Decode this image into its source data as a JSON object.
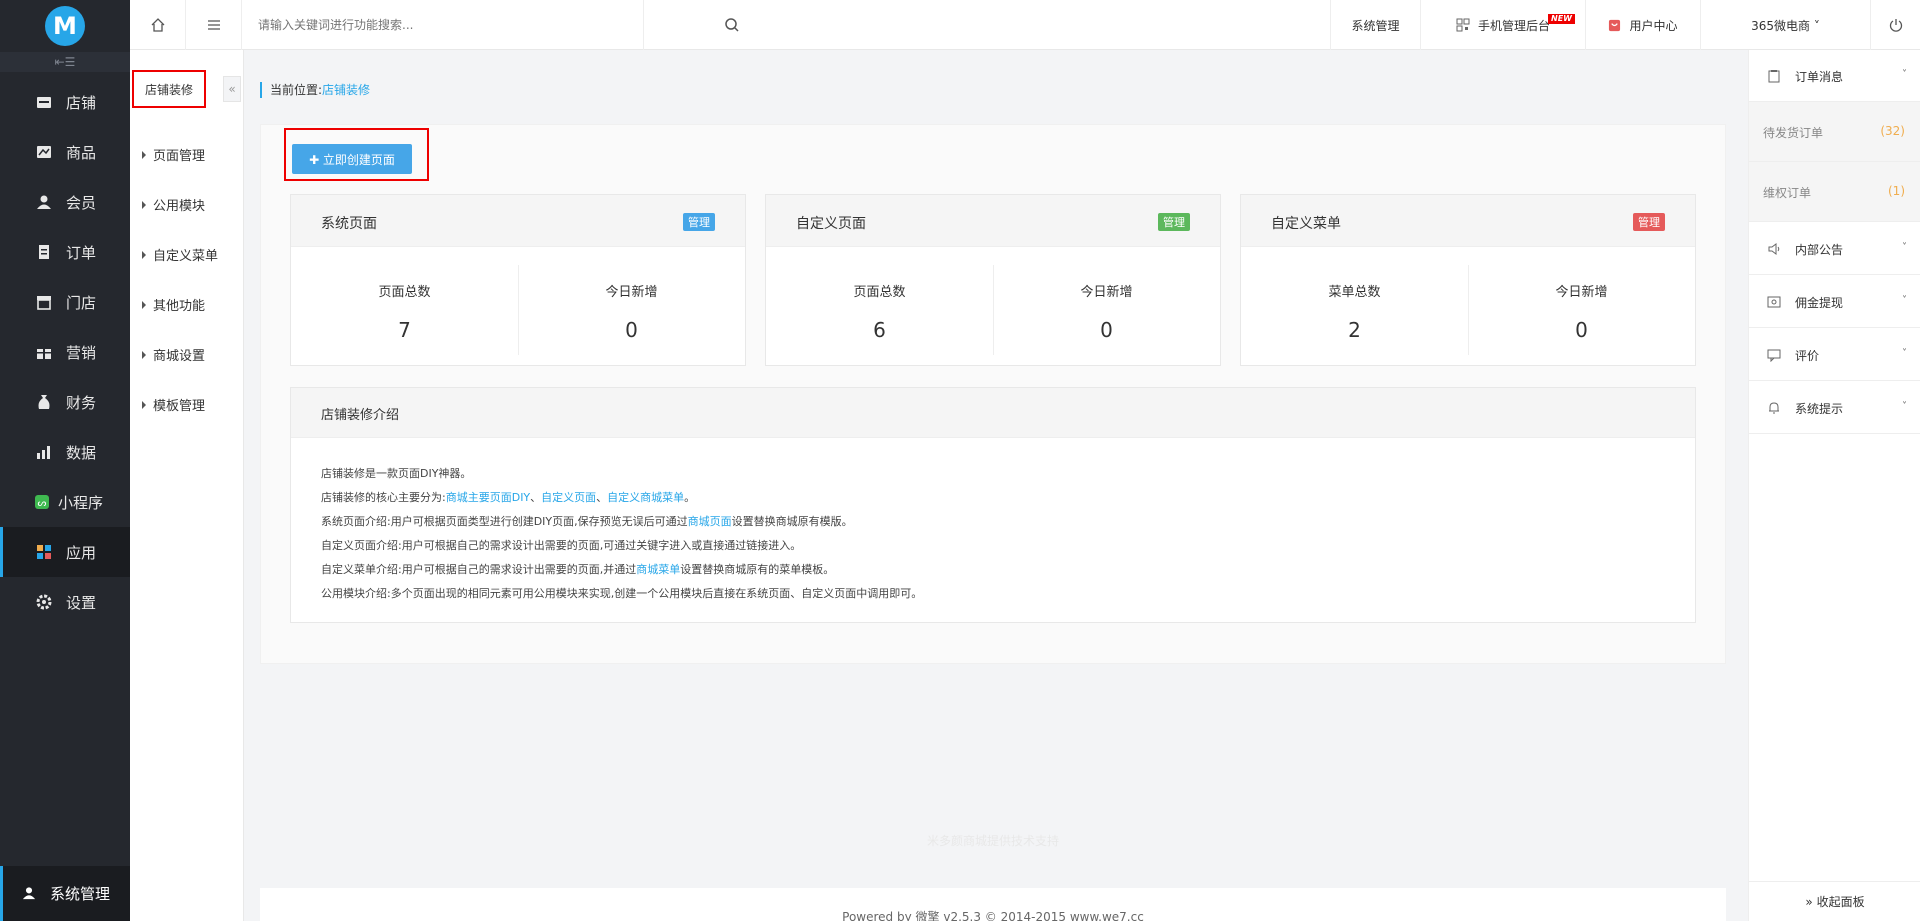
{
  "sidebar": {
    "logo": "M",
    "collapse_glyph": "⇤☰",
    "items": [
      {
        "label": "店铺",
        "icon": "store-icon"
      },
      {
        "label": "商品",
        "icon": "goods-icon"
      },
      {
        "label": "会员",
        "icon": "member-icon"
      },
      {
        "label": "订单",
        "icon": "order-icon"
      },
      {
        "label": "门店",
        "icon": "shop-icon"
      },
      {
        "label": "营销",
        "icon": "marketing-icon"
      },
      {
        "label": "财务",
        "icon": "finance-icon"
      },
      {
        "label": "数据",
        "icon": "data-icon"
      },
      {
        "label": "小程序",
        "icon": "miniprogram-icon"
      },
      {
        "label": "应用",
        "icon": "apps-icon"
      },
      {
        "label": "设置",
        "icon": "settings-icon"
      }
    ],
    "active_index": 9,
    "bottom": {
      "label": "系统管理",
      "icon": "user-admin-icon"
    }
  },
  "subsidebar": {
    "active": "店铺装修",
    "collapse_glyph": "«",
    "items": [
      "页面管理",
      "公用模块",
      "自定义菜单",
      "其他功能",
      "商城设置",
      "模板管理"
    ]
  },
  "topbar": {
    "search_placeholder": "请输入关键词进行功能搜索...",
    "system_manage": "系统管理",
    "mobile_admin": "手机管理后台",
    "new_badge": "NEW",
    "user_center": "用户中心",
    "shop_name": "365微电商 ˅"
  },
  "breadcrumb": {
    "prefix": "当前位置:",
    "current": "店铺装修"
  },
  "create_button": "✚ 立即创建页面",
  "cards": [
    {
      "title": "系统页面",
      "badge": "管理",
      "badge_color": "#46a6e8",
      "stats": [
        {
          "label": "页面总数",
          "value": "7"
        },
        {
          "label": "今日新增",
          "value": "0"
        }
      ]
    },
    {
      "title": "自定义页面",
      "badge": "管理",
      "badge_color": "#5cb85c",
      "stats": [
        {
          "label": "页面总数",
          "value": "6"
        },
        {
          "label": "今日新增",
          "value": "0"
        }
      ]
    },
    {
      "title": "自定义菜单",
      "badge": "管理",
      "badge_color": "#e55a5a",
      "stats": [
        {
          "label": "菜单总数",
          "value": "2"
        },
        {
          "label": "今日新增",
          "value": "0"
        }
      ]
    }
  ],
  "intro": {
    "title": "店铺装修介绍",
    "line1": "店铺装修是一款页面DIY神器。",
    "line2_prefix": "店铺装修的核心主要分为:",
    "line2_link1": "商城主要页面DIY",
    "line2_sep1": "、",
    "line2_link2": "自定义页面",
    "line2_sep2": "、",
    "line2_link3": "自定义商城菜单",
    "line2_end": "。",
    "line3_prefix": "系统页面介绍:用户可根据页面类型进行创建DIY页面,保存预览无误后可通过",
    "line3_link": "商城页面",
    "line3_suffix": "设置替换商城原有模版。",
    "line4": "自定义页面介绍:用户可根据自己的需求设计出需要的页面,可通过关键字进入或直接通过链接进入。",
    "line5_prefix": "自定义菜单介绍:用户可根据自己的需求设计出需要的页面,并通过",
    "line5_link": "商城菜单",
    "line5_suffix": "设置替换商城原有的菜单模板。",
    "line6": "公用模块介绍:多个页面出现的相同元素可用公用模块来实现,创建一个公用模块后直接在系统页面、自定义页面中调用即可。"
  },
  "watermark": "米多颜商城提供技术支持",
  "footer": "Powered by 微擎 v2.5.3 © 2014-2015 www.we7.cc",
  "rightpanel": {
    "order_msg": "订单消息",
    "pending": {
      "label": "待发货订单",
      "count": "(32)"
    },
    "rights": {
      "label": "维权订单",
      "count": "(1)"
    },
    "notice": "内部公告",
    "withdraw": "佣金提现",
    "review": "评价",
    "sys_tip": "系统提示",
    "collapse": "» 收起面板"
  }
}
